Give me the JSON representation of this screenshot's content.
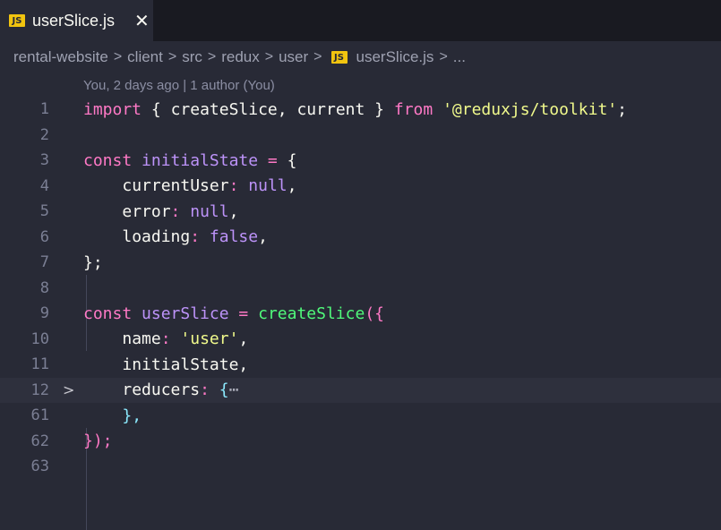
{
  "tab": {
    "icon": "JS",
    "title": "userSlice.js",
    "close": "✕"
  },
  "breadcrumb": {
    "parts": [
      "rental-website",
      "client",
      "src",
      "redux",
      "user"
    ],
    "file": "userSlice.js",
    "more": "...",
    "separator": ">"
  },
  "codelens": "You, 2 days ago | 1 author (You)",
  "lines": [
    {
      "n": "1"
    },
    {
      "n": "2"
    },
    {
      "n": "3"
    },
    {
      "n": "4"
    },
    {
      "n": "5"
    },
    {
      "n": "6"
    },
    {
      "n": "7"
    },
    {
      "n": "8"
    },
    {
      "n": "9"
    },
    {
      "n": "10"
    },
    {
      "n": "11"
    },
    {
      "n": "12"
    },
    {
      "n": "61"
    },
    {
      "n": "62"
    },
    {
      "n": "63"
    }
  ],
  "tokens": {
    "import": "import",
    "lb": "{",
    "createSlice": "createSlice",
    "comma": ",",
    "current": "current",
    "rb": "}",
    "from": "from",
    "module": "'@reduxjs/toolkit'",
    "semi": ";",
    "const": "const",
    "initialState": "initialState",
    "eq": "=",
    "currentUser": "currentUser",
    "colon": ":",
    "null": "null",
    "error": "error",
    "loading": "loading",
    "false": "false",
    "closeObj": "};",
    "userSlice": "userSlice",
    "callOpen": "({",
    "name": "name",
    "userStr": "'user'",
    "reducers": "reducers",
    "ellipsis": "⋯",
    "closeBrace": "},",
    "callClose": "});"
  },
  "colors": {
    "background": "#282a36",
    "keyword": "#ff79c6",
    "variable": "#bd93f9",
    "function": "#50fa7b",
    "string": "#f1fa8c",
    "brace": "#8be9fd"
  }
}
